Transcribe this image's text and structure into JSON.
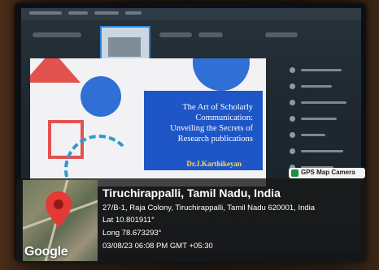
{
  "slide": {
    "title_lines": [
      "The Art of Scholarly",
      "Communication:",
      "Unveiling the Secrets of",
      "Research publications"
    ],
    "author": "Dr.J.Karthikeyan"
  },
  "gps_stamp": {
    "app_name": "GPS Map Camera",
    "location_title": "Tiruchirappalli, Tamil Nadu, India",
    "address": "27/B-1, Raja Colony, Tiruchirappalli, Tamil Nadu 620001, India",
    "latitude": "Lat 10.801911°",
    "longitude": "Long 78.673293°",
    "datetime": "03/08/23 06:08 PM GMT +05:30",
    "map_brand": "Google"
  },
  "colors": {
    "slide_blue": "#2f6fd6",
    "title_block": "#1e56c8",
    "accent_red": "#e2524f",
    "author_yellow": "#ffd94a",
    "gps_green": "#1f8f43"
  }
}
